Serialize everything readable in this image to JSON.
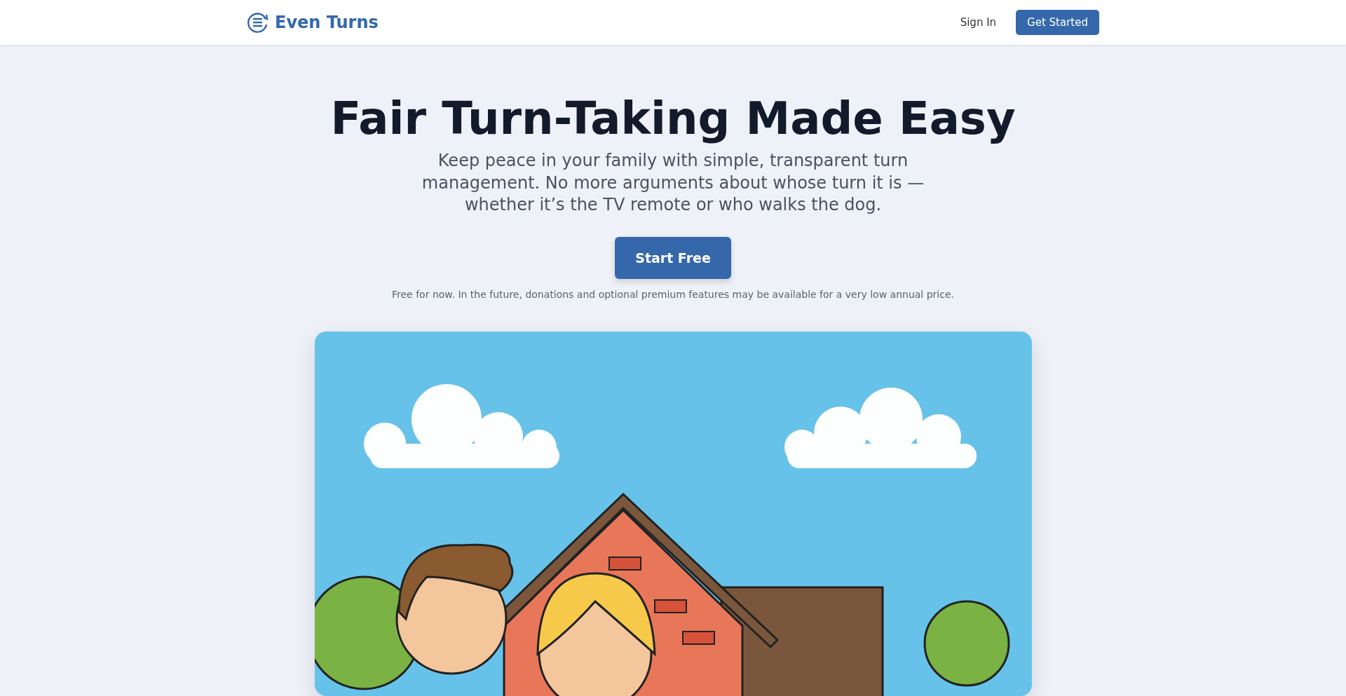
{
  "header": {
    "brand": "Even Turns",
    "sign_in": "Sign In",
    "get_started": "Get Started"
  },
  "hero": {
    "title": "Fair Turn-Taking Made Easy",
    "subtitle": "Keep peace in your family with simple, transparent turn management. No more arguments about whose turn it is — whether it’s the TV remote or who walks the dog.",
    "cta": "Start Free",
    "note": "Free for now. In the future, donations and optional premium features may be available for a very low annual price."
  }
}
